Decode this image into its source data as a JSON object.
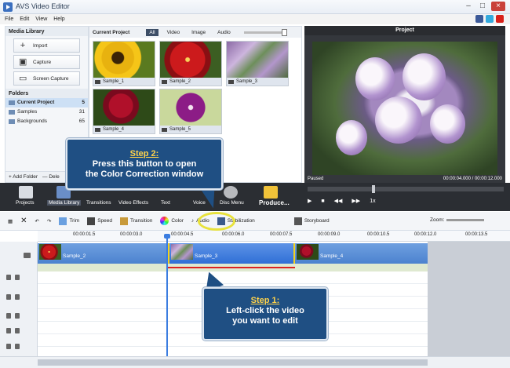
{
  "window": {
    "title": "AVS Video Editor"
  },
  "menu": {
    "items": [
      "File",
      "Edit",
      "View",
      "Help"
    ]
  },
  "social": [
    {
      "name": "facebook",
      "color": "#3b5998"
    },
    {
      "name": "twitter",
      "color": "#33aadd"
    },
    {
      "name": "youtube",
      "color": "#d8211a"
    }
  ],
  "media_library": {
    "title": "Media Library",
    "buttons": [
      {
        "label": "Import",
        "icon": "plus-icon"
      },
      {
        "label": "Capture",
        "icon": "camera-icon"
      },
      {
        "label": "Screen Capture",
        "icon": "monitor-icon"
      }
    ],
    "folders_title": "Folders",
    "folders": [
      {
        "name": "Current Project",
        "count": "5"
      },
      {
        "name": "Samples",
        "count": "31"
      },
      {
        "name": "Backgrounds",
        "count": "65"
      }
    ],
    "add_folder": "+ Add Folder",
    "delete": "— Dele"
  },
  "current_project": {
    "title": "Current Project",
    "filters": [
      "All",
      "Video",
      "Image",
      "Audio"
    ],
    "thumbs": [
      "Sample_1",
      "Sample_2",
      "Sample_3",
      "Sample_4",
      "Sample_5"
    ]
  },
  "project_preview": {
    "title": "Project",
    "status": "Paused",
    "time": "00:00:04.000 / 00:00:12.000",
    "speed": "1x"
  },
  "tasks": [
    "Projects",
    "Media Library",
    "Transitions",
    "Video Effects",
    "Text",
    "Voice",
    "Disc Menu",
    "Produce..."
  ],
  "toolbar": {
    "trim": "Trim",
    "speed": "Speed",
    "transition": "Transition",
    "color": "Color",
    "audio": "Audio",
    "stabilization": "Stabilization",
    "storyboard": "Storyboard",
    "zoom": "Zoom:"
  },
  "ruler": [
    "00:00:01.5",
    "00:00:03.0",
    "00:00:04.5",
    "00:00:06.0",
    "00:00:07.5",
    "00:00:09.0",
    "00:00:10.5",
    "00:00:12.0",
    "00:00:13.5"
  ],
  "clips": [
    "Sample_2",
    "Sample_3",
    "Sample_4"
  ],
  "callouts": {
    "step2_head": "Step 2:",
    "step2_line1": "Press this button to open",
    "step2_line2": "the Color Correction window",
    "step1_head": "Step 1:",
    "step1_line1": "Left-click the video",
    "step1_line2": "you want to edit"
  }
}
